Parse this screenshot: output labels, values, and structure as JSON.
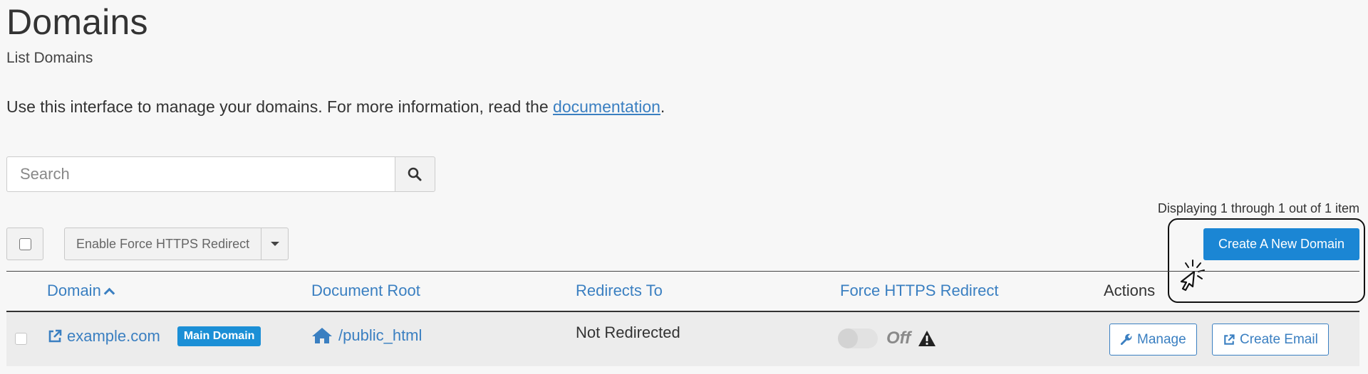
{
  "header": {
    "title": "Domains",
    "subtitle": "List Domains"
  },
  "intro": {
    "text": "Use this interface to manage your domains. For more information, read the ",
    "link_text": "documentation",
    "suffix": "."
  },
  "search": {
    "placeholder": "Search",
    "value": "",
    "icon": "search-icon"
  },
  "pagination": {
    "summary": "Displaying 1 through 1 out of 1 item"
  },
  "toolbar": {
    "bulk_action_label": "Enable Force HTTPS Redirect",
    "create_label": "Create A New Domain"
  },
  "table": {
    "columns": [
      "Domain",
      "Document Root",
      "Redirects To",
      "Force HTTPS Redirect",
      "Actions"
    ],
    "sorted_by": "Domain",
    "sort_direction": "ascending",
    "rows": [
      {
        "domain": "example.com",
        "badge": "Main Domain",
        "document_root": "/public_html",
        "redirects_to": "Not Redirected",
        "force_https": "Off",
        "actions": [
          "Manage",
          "Create Email"
        ]
      }
    ]
  },
  "colors": {
    "link": "#3a7fc1",
    "primary_button": "#1b86d4",
    "badge": "#1b8fd6",
    "row_background": "#ececec"
  }
}
